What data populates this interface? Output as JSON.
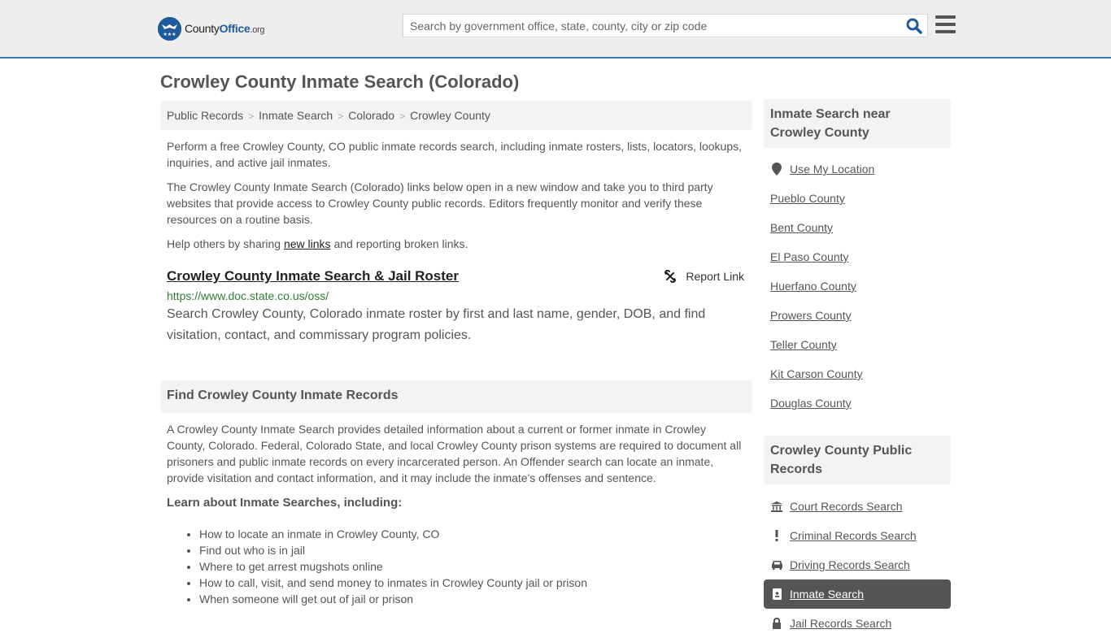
{
  "header": {
    "logo": {
      "county": "County",
      "office": "Office",
      "tld": ".org"
    },
    "search": {
      "placeholder": "Search by government office, state, county, city or zip code",
      "value": ""
    },
    "icons": {
      "search": "search-icon",
      "menu": "hamburger-menu-icon"
    }
  },
  "page": {
    "title": "Crowley County Inmate Search (Colorado)",
    "breadcrumb": [
      "Public Records",
      "Inmate Search",
      "Colorado",
      "Crowley County"
    ],
    "intro": [
      "Perform a free Crowley County, CO public inmate records search, including inmate rosters, lists, locators, lookups, inquiries, and active jail inmates.",
      "The Crowley County Inmate Search (Colorado) links below open in a new window and take you to third party websites that provide access to Crowley County public records. Editors frequently monitor and verify these resources on a routine basis."
    ],
    "share": {
      "before": "Help others by sharing ",
      "link": "new links",
      "after": " and reporting broken links."
    },
    "result": {
      "title": "Crowley County Inmate Search & Jail Roster",
      "url": "https://www.doc.state.co.us/oss/",
      "description": "Search Crowley County, Colorado inmate roster by first and last name, gender, DOB, and find visitation, contact, and commissary program policies.",
      "report_label": "Report Link"
    },
    "find_section": {
      "heading": "Find Crowley County Inmate Records",
      "body": "A Crowley County Inmate Search provides detailed information about a current or former inmate in Crowley County, Colorado. Federal, Colorado State, and local Crowley County prison systems are required to document all prisoners and public inmate records on every incarcerated person. An Offender search can locate an inmate, provide visitation and contact information, and it may include the inmate's offenses and sentence.",
      "learn_heading": "Learn about Inmate Searches, including:",
      "bullets": [
        "How to locate an inmate in Crowley County, CO",
        "Find out who is in jail",
        "Where to get arrest mugshots online",
        "How to call, visit, and send money to inmates in Crowley County jail or prison",
        "When someone will get out of jail or prison"
      ]
    }
  },
  "sidebar": {
    "nearby": {
      "heading": "Inmate Search near Crowley County",
      "use_location": "Use My Location",
      "counties": [
        "Pueblo County",
        "Bent County",
        "El Paso County",
        "Huerfano County",
        "Prowers County",
        "Teller County",
        "Kit Carson County",
        "Douglas County"
      ]
    },
    "public_records": {
      "heading": "Crowley County Public Records",
      "items": [
        {
          "label": "Court Records Search",
          "icon": "courthouse-icon"
        },
        {
          "label": "Criminal Records Search",
          "icon": "exclamation-icon"
        },
        {
          "label": "Driving Records Search",
          "icon": "car-icon"
        },
        {
          "label": "Inmate Search",
          "icon": "id-badge-icon",
          "active": true
        },
        {
          "label": "Jail Records Search",
          "icon": "lock-icon"
        }
      ]
    }
  },
  "colors": {
    "accent": "#2f79b5",
    "brand": "#1e5a9c",
    "url_green": "#2e7d32",
    "active_bg": "#555555"
  }
}
